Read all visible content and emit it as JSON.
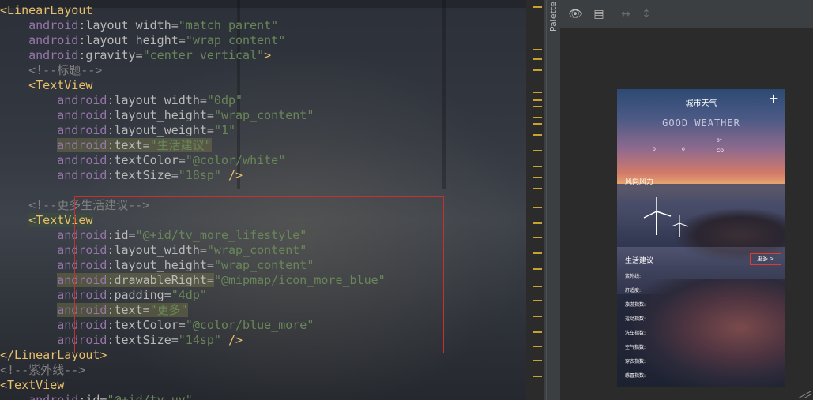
{
  "editor": {
    "lines": [
      [
        {
          "c": "tag",
          "t": "<LinearLayout"
        }
      ],
      [
        {
          "c": "sp",
          "t": "    "
        },
        {
          "c": "attr-ns",
          "t": "android"
        },
        {
          "c": "attr-name",
          "t": ":layout_width="
        },
        {
          "c": "val",
          "t": "\"match_parent\""
        }
      ],
      [
        {
          "c": "sp",
          "t": "    "
        },
        {
          "c": "attr-ns",
          "t": "android"
        },
        {
          "c": "attr-name",
          "t": ":layout_height="
        },
        {
          "c": "val",
          "t": "\"wrap_content\""
        }
      ],
      [
        {
          "c": "sp",
          "t": "    "
        },
        {
          "c": "attr-ns",
          "t": "android"
        },
        {
          "c": "attr-name",
          "t": ":gravity="
        },
        {
          "c": "val",
          "t": "\"center_vertical\""
        },
        {
          "c": "tag",
          "t": ">"
        }
      ],
      [
        {
          "c": "sp",
          "t": "    "
        },
        {
          "c": "cmt",
          "t": "<!--标题-->"
        }
      ],
      [
        {
          "c": "sp",
          "t": "    "
        },
        {
          "c": "tag",
          "t": "<TextView"
        }
      ],
      [
        {
          "c": "sp",
          "t": "        "
        },
        {
          "c": "attr-ns",
          "t": "android"
        },
        {
          "c": "attr-name",
          "t": ":layout_width="
        },
        {
          "c": "val",
          "t": "\"0dp\""
        }
      ],
      [
        {
          "c": "sp",
          "t": "        "
        },
        {
          "c": "attr-ns",
          "t": "android"
        },
        {
          "c": "attr-name",
          "t": ":layout_height="
        },
        {
          "c": "val",
          "t": "\"wrap_content\""
        }
      ],
      [
        {
          "c": "sp",
          "t": "        "
        },
        {
          "c": "attr-ns",
          "t": "android"
        },
        {
          "c": "attr-name",
          "t": ":layout_weight="
        },
        {
          "c": "val",
          "t": "\"1\""
        }
      ],
      [
        {
          "c": "sp",
          "t": "        "
        },
        {
          "c": "attr-ns hl",
          "t": "android"
        },
        {
          "c": "attr-name hl",
          "t": ":text="
        },
        {
          "c": "val hl",
          "t": "\"生活建议\""
        }
      ],
      [
        {
          "c": "sp",
          "t": "        "
        },
        {
          "c": "attr-ns",
          "t": "android"
        },
        {
          "c": "attr-name",
          "t": ":textColor="
        },
        {
          "c": "val",
          "t": "\"@color/white\""
        }
      ],
      [
        {
          "c": "sp",
          "t": "        "
        },
        {
          "c": "attr-ns",
          "t": "android"
        },
        {
          "c": "attr-name",
          "t": ":textSize="
        },
        {
          "c": "val",
          "t": "\"18sp\""
        },
        {
          "c": "tag",
          "t": " />"
        }
      ],
      [
        {
          "c": "sp",
          "t": ""
        }
      ],
      [
        {
          "c": "sp",
          "t": "    "
        },
        {
          "c": "cmt",
          "t": "<!--更多生活建议-->"
        }
      ],
      [
        {
          "c": "sp",
          "t": "    "
        },
        {
          "c": "tag hl-tag",
          "t": "<TextView"
        }
      ],
      [
        {
          "c": "sp",
          "t": "        "
        },
        {
          "c": "attr-ns",
          "t": "android"
        },
        {
          "c": "attr-name",
          "t": ":id="
        },
        {
          "c": "val",
          "t": "\"@+id/tv_more_lifestyle\""
        }
      ],
      [
        {
          "c": "sp",
          "t": "        "
        },
        {
          "c": "attr-ns",
          "t": "android"
        },
        {
          "c": "attr-name",
          "t": ":layout_width="
        },
        {
          "c": "val",
          "t": "\"wrap_content\""
        }
      ],
      [
        {
          "c": "sp",
          "t": "        "
        },
        {
          "c": "attr-ns",
          "t": "android"
        },
        {
          "c": "attr-name",
          "t": ":layout_height="
        },
        {
          "c": "val",
          "t": "\"wrap_content\""
        }
      ],
      [
        {
          "c": "sp",
          "t": "        "
        },
        {
          "c": "attr-ns hl",
          "t": "android"
        },
        {
          "c": "attr-name hl",
          "t": ":drawableRight="
        },
        {
          "c": "val",
          "t": "\"@mipmap/icon_more_blue\""
        }
      ],
      [
        {
          "c": "sp",
          "t": "        "
        },
        {
          "c": "attr-ns",
          "t": "android"
        },
        {
          "c": "attr-name",
          "t": ":padding="
        },
        {
          "c": "val",
          "t": "\"4dp\""
        }
      ],
      [
        {
          "c": "sp",
          "t": "        "
        },
        {
          "c": "attr-ns hl",
          "t": "android"
        },
        {
          "c": "attr-name hl",
          "t": ":text="
        },
        {
          "c": "val hl",
          "t": "\"更多\""
        }
      ],
      [
        {
          "c": "sp",
          "t": "        "
        },
        {
          "c": "attr-ns",
          "t": "android"
        },
        {
          "c": "attr-name",
          "t": ":textColor="
        },
        {
          "c": "val",
          "t": "\"@color/blue_more\""
        }
      ],
      [
        {
          "c": "sp",
          "t": "        "
        },
        {
          "c": "attr-ns",
          "t": "android"
        },
        {
          "c": "attr-name",
          "t": ":textSize="
        },
        {
          "c": "val",
          "t": "\"14sp\""
        },
        {
          "c": "tag",
          "t": " />"
        }
      ],
      [
        {
          "c": "tag",
          "t": "</LinearLayout>"
        }
      ],
      [
        {
          "c": "cmt",
          "t": "<!--紫外线-->"
        }
      ],
      [
        {
          "c": "tag",
          "t": "<TextView"
        }
      ],
      [
        {
          "c": "sp",
          "t": "    "
        },
        {
          "c": "attr-ns",
          "t": "android"
        },
        {
          "c": "attr-name",
          "t": ":id="
        },
        {
          "c": "val",
          "t": "\"@+id/tv_uv\""
        }
      ]
    ]
  },
  "side_panel": {
    "label": "Palette"
  },
  "design_toolbar": {
    "eye_icon": "eye-icon",
    "layers_icon": "layers-icon",
    "h_resize_icon": "horizontal-arrows-icon",
    "v_resize_icon": "vertical-arrows-icon"
  },
  "phone": {
    "title": "城市天气",
    "add_icon": "+",
    "brand": "GOOD WEATHER",
    "nums": [
      "0",
      "0",
      "0°",
      "CO"
    ],
    "wind_label": "风向风力",
    "lifestyle_label": "生活建议",
    "more_label": "更多 >",
    "items": [
      "紫外线:",
      "舒适度:",
      "旅游指数:",
      "运动指数:",
      "洗车指数:",
      "空气指数:",
      "穿衣指数:",
      "感冒指数:"
    ]
  },
  "colors": {
    "highlight_border": "#c9302c",
    "tag": "#e8bf6a",
    "value": "#6a8759",
    "namespace": "#9876aa",
    "comment": "#808080"
  }
}
